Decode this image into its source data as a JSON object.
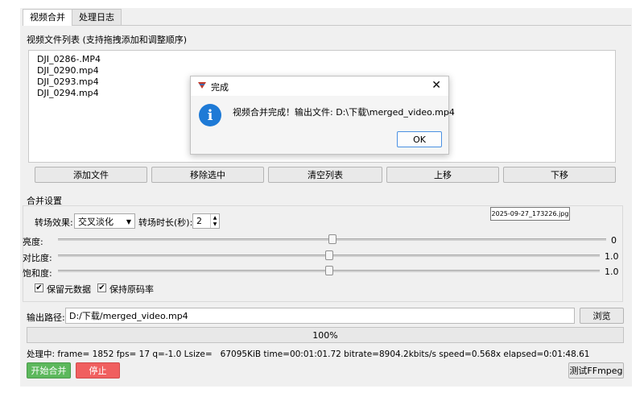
{
  "tabs": [
    {
      "label": "视频合并",
      "active": true
    },
    {
      "label": "处理日志",
      "active": false
    }
  ],
  "file_list": {
    "title": "视频文件列表 (支持拖拽添加和调整顺序)",
    "items": [
      "DJI_0286-.MP4",
      "DJI_0290.mp4",
      "DJI_0293.mp4",
      "DJI_0294.mp4"
    ]
  },
  "list_buttons": {
    "add": "添加文件",
    "remove": "移除选中",
    "clear": "清空列表",
    "up": "上移",
    "down": "下移"
  },
  "settings": {
    "title": "合并设置",
    "transition_label": "转场效果:",
    "transition_value": "交叉淡化",
    "duration_label": "转场时长(秒):",
    "duration_value": "2",
    "sliders": [
      {
        "label": "亮度:",
        "value_text": "0",
        "level": 0.5
      },
      {
        "label": "对比度:",
        "value_text": "1.0",
        "level": 0.5
      },
      {
        "label": "饱和度:",
        "value_text": "1.0",
        "level": 0.5
      }
    ],
    "keep_metadata": {
      "label": "保留元数据",
      "checked": true
    },
    "keep_bitrate": {
      "label": "保持原码率",
      "checked": true
    }
  },
  "tooltip": "2025-09-27_173226.jpg",
  "output": {
    "label": "输出路径:",
    "value": "D:/下载/merged_video.mp4",
    "browse": "浏览"
  },
  "progress": {
    "text": "100%",
    "percent": 100
  },
  "status": "处理中: frame= 1852 fps= 17 q=-1.0 Lsize=   67095KiB time=00:01:01.72 bitrate=8904.2kbits/s speed=0.568x elapsed=0:01:48.61",
  "bottom_buttons": {
    "start": "开始合并",
    "stop": "停止",
    "test": "测试FFmpeg"
  },
  "dialog": {
    "title": "完成",
    "message": "视频合并完成！输出文件: D:\\下载\\merged_video.mp4",
    "ok": "OK"
  },
  "colors": {
    "start_button": "#5cb85c",
    "stop_button": "#f05f5f",
    "info_icon": "#1e7ad6"
  }
}
